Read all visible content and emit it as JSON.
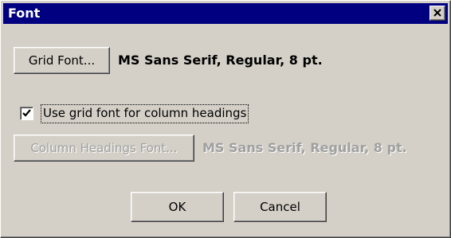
{
  "window": {
    "title": "Font",
    "close_icon": "close-x-icon"
  },
  "grid_font": {
    "button_label": "Grid Font...",
    "description": "MS Sans Serif, Regular, 8 pt."
  },
  "column_headings": {
    "checkbox_label": "Use grid font for column headings",
    "checked": true,
    "button_label": "Column Headings Font...",
    "description": "MS Sans Serif, Regular, 8 pt.",
    "enabled": false
  },
  "actions": {
    "ok_label": "OK",
    "cancel_label": "Cancel"
  },
  "colors": {
    "titlebar": "#000080",
    "face": "#d4d0c8",
    "disabled_text": "#a0a0a0"
  }
}
